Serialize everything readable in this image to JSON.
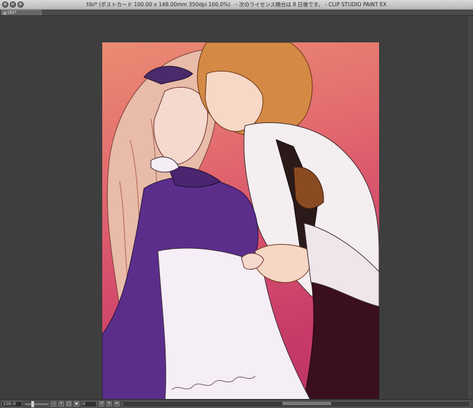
{
  "window": {
    "title": "tibi* (ポストカード 100.00 x 148.00mm 350dpi 100.0%)　- 次のライセンス開合は 8 日後です。 - CLIP STUDIO PAINT EX",
    "buttons": [
      {
        "name": "close-button",
        "glyph": "×"
      },
      {
        "name": "minimize-button",
        "glyph": "−"
      },
      {
        "name": "zoom-button",
        "glyph": "+"
      }
    ]
  },
  "tabs": [
    {
      "label": "tibi*",
      "active": true
    }
  ],
  "canvas": {
    "background_color": "#3e3e3e",
    "artwork_description_colors": {
      "gradient_top": "#ea8c72",
      "gradient_bottom": "#b93466",
      "dress": "#5a2e8a",
      "apron": "#f6eef6",
      "hair_left": "#e5b7a5",
      "hair_right": "#d48a45",
      "shirt": "#f3ecef",
      "trousers": "#3a0f1e"
    }
  },
  "status_bar": {
    "zoom_value": "100.0",
    "zoom_slider_fraction": 0.25,
    "angle_value": "0",
    "scroll_thumb": {
      "start": 0.46,
      "width": 0.14
    }
  }
}
